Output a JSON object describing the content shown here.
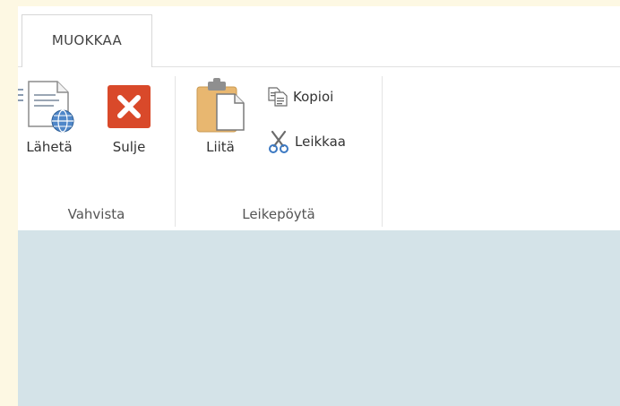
{
  "ribbon": {
    "tabs": [
      {
        "label": "MUOKKAA",
        "active": true
      }
    ],
    "groups": [
      {
        "label": "Vahvista",
        "buttons": [
          {
            "label": "Lähetä",
            "icon": "send-document-globe-icon"
          },
          {
            "label": "Sulje",
            "icon": "close-x-icon"
          }
        ]
      },
      {
        "label": "Leikepöytä",
        "buttons": [
          {
            "label": "Liitä",
            "icon": "paste-clipboard-icon"
          },
          {
            "label": "Kopioi",
            "icon": "copy-icon"
          },
          {
            "label": "Leikkaa",
            "icon": "scissors-icon"
          }
        ]
      }
    ]
  },
  "colors": {
    "outer_background": "#fdf8e3",
    "content_background": "#d4e3e8",
    "close_red": "#d9492a",
    "clipboard_tan": "#e8b770"
  }
}
